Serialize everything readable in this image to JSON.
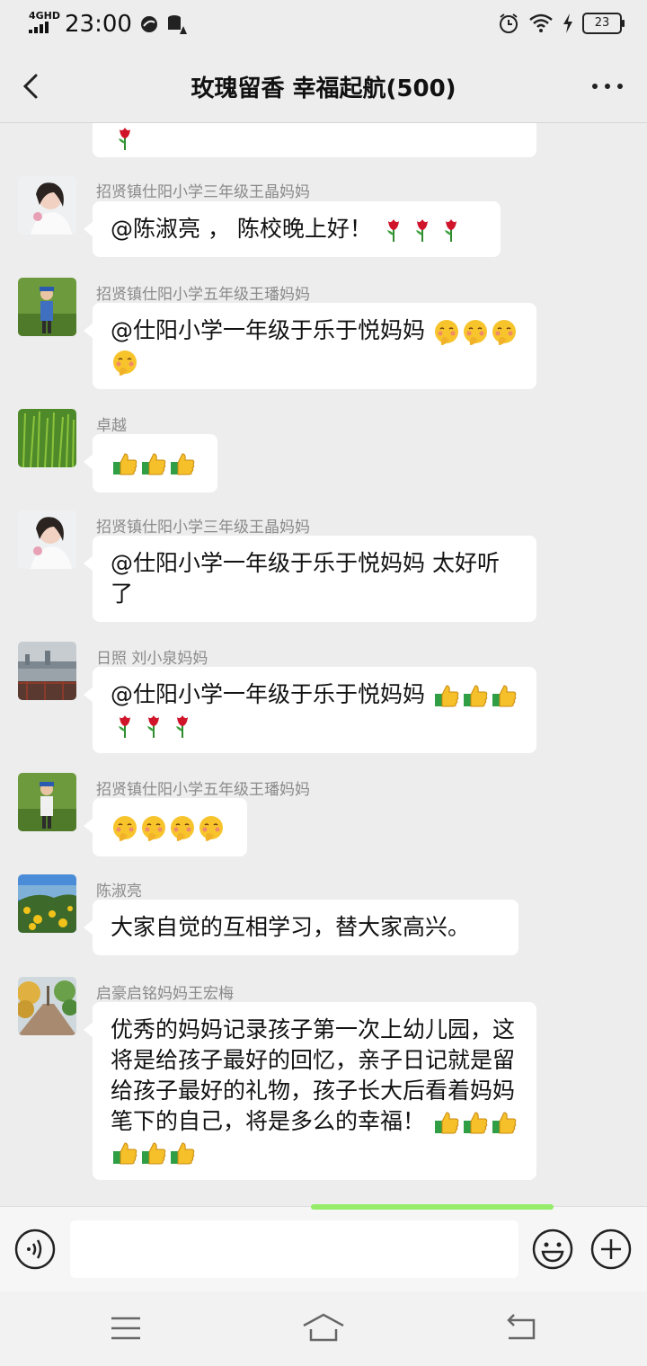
{
  "status_bar": {
    "network": "4GHD",
    "time": "23:00",
    "battery": "23"
  },
  "header": {
    "title": "玫瑰留香  幸福起航(500)"
  },
  "messages": [
    {
      "sender": "招贤镇仕阳小学三年级王晶妈妈",
      "text": "@陈淑亮 ， 陈校晚上好！",
      "emoji": [
        "rose",
        "rose",
        "rose"
      ]
    },
    {
      "sender": "招贤镇仕阳小学五年级王璠妈妈",
      "text": "@仕阳小学一年级于乐于悦妈妈",
      "emoji": [
        "shy",
        "shy",
        "shy",
        "shy"
      ]
    },
    {
      "sender": "卓越",
      "text": "",
      "emoji": [
        "thumbs-up",
        "thumbs-up",
        "thumbs-up"
      ]
    },
    {
      "sender": "招贤镇仕阳小学三年级王晶妈妈",
      "text": "@仕阳小学一年级于乐于悦妈妈  太好听了",
      "emoji": []
    },
    {
      "sender": "日照  刘小泉妈妈",
      "text": "@仕阳小学一年级于乐于悦妈妈",
      "emoji": [
        "thumbs-up",
        "thumbs-up",
        "thumbs-up",
        "rose",
        "rose",
        "rose"
      ]
    },
    {
      "sender": "招贤镇仕阳小学五年级王璠妈妈",
      "text": "",
      "emoji": [
        "shy",
        "shy",
        "shy",
        "shy"
      ]
    },
    {
      "sender": "陈淑亮",
      "text": "大家自觉的互相学习，替大家高兴。",
      "emoji": []
    },
    {
      "sender": "启豪启铭妈妈王宏梅",
      "text": "优秀的妈妈记录孩子第一次上幼儿园，这将是给孩子最好的回忆，亲子日记就是留给孩子最好的礼物，孩子长大后看着妈妈笔下的自己，将是多么的幸福！",
      "emoji": [
        "thumbs-up",
        "thumbs-up",
        "thumbs-up",
        "thumbs-up",
        "thumbs-up",
        "thumbs-up"
      ]
    }
  ],
  "input": {
    "value": ""
  }
}
